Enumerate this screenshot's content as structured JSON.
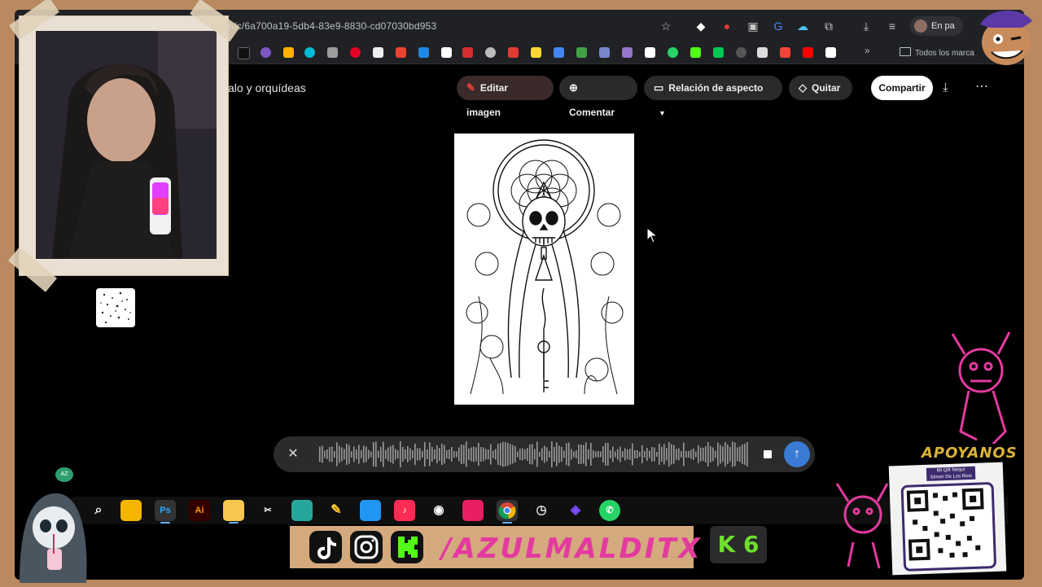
{
  "browser": {
    "url": "om/c/6a700a19-5db4-83e9-8830-cd07030bd953",
    "profile_label": "En pa",
    "bookmarks_folder": "Todos los marca"
  },
  "toolbar": {
    "title": "alo y orquídeas",
    "edit_image": "Editar imagen",
    "comment": "Comentar",
    "aspect_ratio": "Relación de aspecto",
    "remove": "Quitar",
    "share": "Compartir"
  },
  "taskbar": {
    "apps": [
      "search-icon",
      "chrome-canary",
      "Ps",
      "Ai",
      "file-explorer",
      "capcut",
      "gimp",
      "paint",
      "app-blue",
      "tiktok",
      "obs",
      "app-pink",
      "chrome",
      "clock",
      "app-purple",
      "whatsapp"
    ]
  },
  "overlay": {
    "handle": "/AZULMALDITX",
    "k6": "K 6",
    "apoyanos": "APOYANOS",
    "qr_title": "Mi QR Nequi",
    "qr_name": "Simon De Los Rios",
    "badge": "AZ"
  },
  "colors": {
    "accent": "#3a7bd5",
    "brand_pink": "#e43aa0",
    "k6_green": "#6ee02d"
  }
}
